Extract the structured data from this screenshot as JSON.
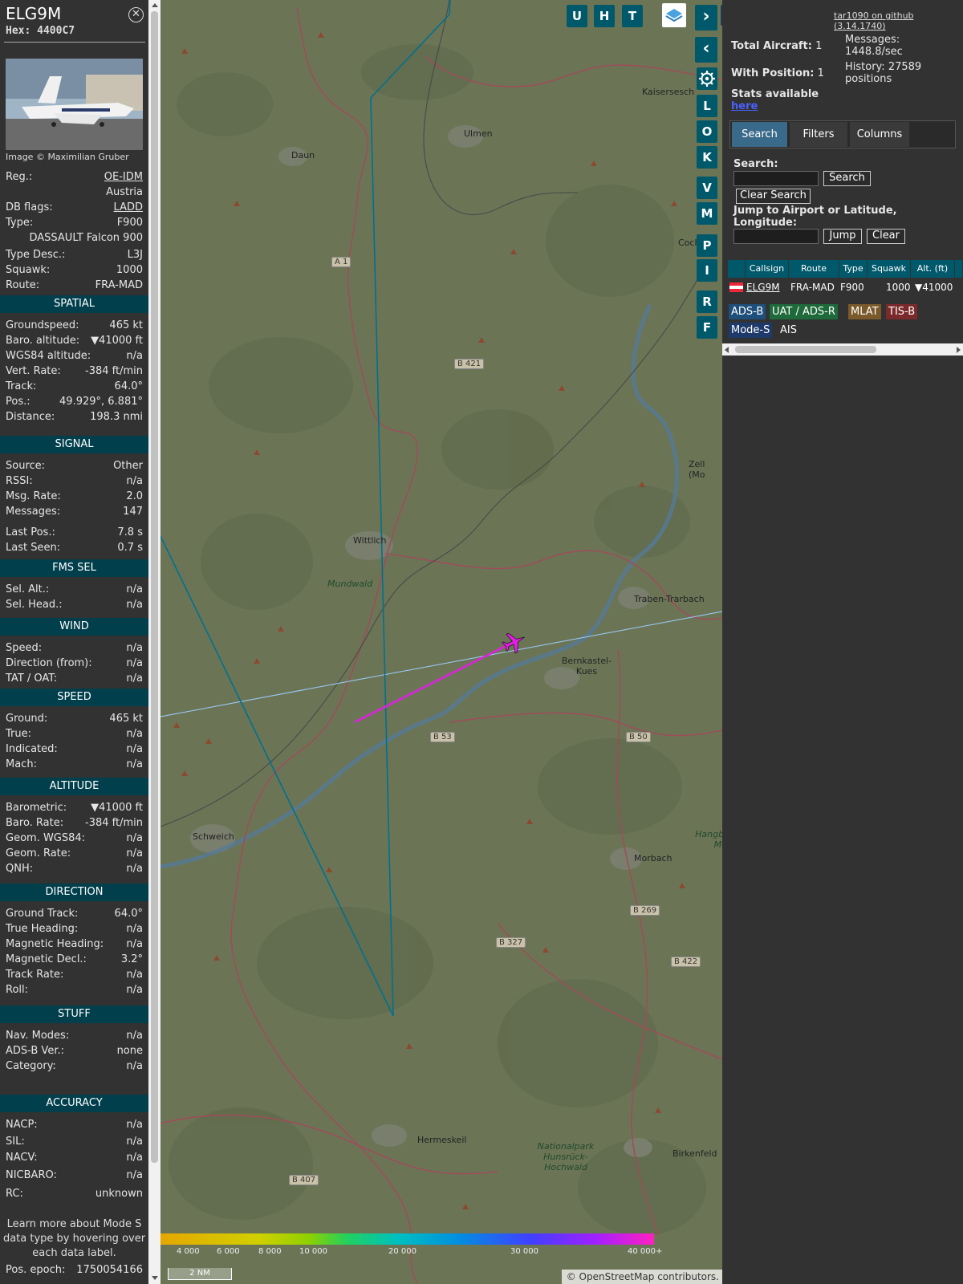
{
  "aircraft": {
    "callsign": "ELG9M",
    "hex_label": "Hex:",
    "hex": "4400C7",
    "photo_credit": "Image © Maximilian Gruber",
    "close_icon": "x"
  },
  "info": [
    {
      "k": "Reg.:",
      "v": "OE-IDM",
      "link": true
    },
    {
      "k": "",
      "v": "Austria"
    },
    {
      "k": "DB flags:",
      "v": "LADD",
      "link": true
    },
    {
      "k": "Type:",
      "v": "F900"
    },
    {
      "k": "",
      "v": "DASSAULT Falcon 900"
    },
    {
      "k": "Type Desc.:",
      "v": "L3J"
    },
    {
      "k": "Squawk:",
      "v": "1000"
    },
    {
      "k": "Route:",
      "v": "FRA-MAD"
    }
  ],
  "sections": {
    "spatial": {
      "title": "SPATIAL",
      "rows": [
        {
          "k": "Groundspeed:",
          "v": "465 kt"
        },
        {
          "k": "Baro. altitude:",
          "v": "▼41000 ft"
        },
        {
          "k": "WGS84 altitude:",
          "v": "n/a"
        },
        {
          "k": "Vert. Rate:",
          "v": "-384 ft/min"
        },
        {
          "k": "Track:",
          "v": "64.0°"
        },
        {
          "k": "Pos.:",
          "v": "49.929°, 6.881°"
        },
        {
          "k": "Distance:",
          "v": "198.3 nmi"
        }
      ]
    },
    "signal": {
      "title": "SIGNAL",
      "rows": [
        {
          "k": "Source:",
          "v": "Other"
        },
        {
          "k": "RSSI:",
          "v": "n/a"
        },
        {
          "k": "Msg. Rate:",
          "v": "2.0"
        },
        {
          "k": "Messages:",
          "v": "147"
        },
        {
          "k": "Last Pos.:",
          "v": "7.8 s"
        },
        {
          "k": "Last Seen:",
          "v": "0.7 s"
        }
      ]
    },
    "fms": {
      "title": "FMS SEL",
      "rows": [
        {
          "k": "Sel. Alt.:",
          "v": "n/a"
        },
        {
          "k": "Sel. Head.:",
          "v": "n/a"
        }
      ]
    },
    "wind": {
      "title": "WIND",
      "rows": [
        {
          "k": "Speed:",
          "v": "n/a"
        },
        {
          "k": "Direction (from):",
          "v": "n/a"
        },
        {
          "k": "TAT / OAT:",
          "v": "n/a"
        }
      ]
    },
    "speed": {
      "title": "SPEED",
      "rows": [
        {
          "k": "Ground:",
          "v": "465 kt"
        },
        {
          "k": "True:",
          "v": "n/a"
        },
        {
          "k": "Indicated:",
          "v": "n/a"
        },
        {
          "k": "Mach:",
          "v": "n/a"
        }
      ]
    },
    "altitude": {
      "title": "ALTITUDE",
      "rows": [
        {
          "k": "Barometric:",
          "v": "▼41000 ft"
        },
        {
          "k": "Baro. Rate:",
          "v": "-384 ft/min"
        },
        {
          "k": "Geom. WGS84:",
          "v": "n/a"
        },
        {
          "k": "Geom. Rate:",
          "v": "n/a"
        },
        {
          "k": "QNH:",
          "v": "n/a"
        }
      ]
    },
    "direction": {
      "title": "DIRECTION",
      "rows": [
        {
          "k": "Ground Track:",
          "v": "64.0°"
        },
        {
          "k": "True Heading:",
          "v": "n/a"
        },
        {
          "k": "Magnetic Heading:",
          "v": "n/a"
        },
        {
          "k": "Magnetic Decl.:",
          "v": "3.2°"
        },
        {
          "k": "Track Rate:",
          "v": "n/a"
        },
        {
          "k": "Roll:",
          "v": "n/a"
        }
      ]
    },
    "stuff": {
      "title": "STUFF",
      "rows": [
        {
          "k": "Nav. Modes:",
          "v": "n/a"
        },
        {
          "k": "ADS-B Ver.:",
          "v": "none"
        },
        {
          "k": "Category:",
          "v": "n/a"
        }
      ]
    },
    "accuracy": {
      "title": "ACCURACY",
      "rows": [
        {
          "k": "NACP:",
          "v": "n/a"
        },
        {
          "k": "SIL:",
          "v": "n/a"
        },
        {
          "k": "NACV:",
          "v": "n/a"
        },
        {
          "k": "NICBARO:",
          "v": "n/a"
        },
        {
          "k": "RC:",
          "v": "unknown"
        }
      ]
    }
  },
  "footer": {
    "hint": "Learn more about Mode S data type by hovering over each data label.",
    "pos_epoch_label": "Pos. epoch:",
    "pos_epoch": "1750054166"
  },
  "toolbar": {
    "top_buttons": [
      "U",
      "H",
      "T"
    ],
    "side_buttons": [
      "L",
      "O",
      "K",
      "V",
      "M",
      "P",
      "I",
      "R",
      "F"
    ],
    "layers_icon": "layers-icon",
    "settings_icon": "gear-icon"
  },
  "map": {
    "labels": [
      {
        "t": "Kaisersesch"
      },
      {
        "t": "Ulmen"
      },
      {
        "t": "Daun"
      },
      {
        "t": "Coch"
      },
      {
        "t": "Zell (Mo"
      },
      {
        "t": "Wittlich"
      },
      {
        "t": "Mundwald"
      },
      {
        "t": "Traben-Trarbach"
      },
      {
        "t": "Bernkastel-Kues"
      },
      {
        "t": "Schweich"
      },
      {
        "t": "Morbach"
      },
      {
        "t": "Hermeskeil"
      },
      {
        "t": "Birkenfeld"
      },
      {
        "t": "Nationalpark Hunsrück-Hochwald"
      },
      {
        "t": "Hangbru bei Mor"
      }
    ],
    "shields": [
      "A 1",
      "B 421",
      "B 53",
      "B 50",
      "B 269",
      "B 327",
      "B 422",
      "B 407"
    ],
    "legend_labels": [
      "4 000",
      "6 000",
      "8 000",
      "10 000",
      "20 000",
      "30 000",
      "40 000+"
    ],
    "scale": "2 NM",
    "attribution": "© OpenStreetMap contributors."
  },
  "stats": {
    "github": "tar1090 on github (3.14.1740)",
    "total_label": "Total Aircraft:",
    "total": "1",
    "withpos_label": "With Position:",
    "withpos": "1",
    "messages_label": "Messages:",
    "messages": "1448.8/sec",
    "history_label": "History:",
    "history": "27589 positions",
    "stats_label": "Stats available",
    "stats_link": "here"
  },
  "tabs": [
    "Search",
    "Filters",
    "Columns"
  ],
  "search": {
    "label": "Search:",
    "button": "Search",
    "clear_button": "Clear Search",
    "jump_label": "Jump to Airport or Latitude, Longitude:",
    "jump_button": "Jump",
    "clear": "Clear",
    "search_value": "",
    "jump_value": ""
  },
  "table": {
    "columns": [
      "",
      "Callsign",
      "Route",
      "Type",
      "Squawk",
      "Alt. (ft)"
    ],
    "rows": [
      {
        "callsign": "ELG9M",
        "route": "FRA-MAD",
        "type": "F900",
        "squawk": "1000",
        "alt": "▼41000"
      }
    ]
  },
  "badges": [
    {
      "t": "ADS-B",
      "c": "#1e4f7a"
    },
    {
      "t": "UAT / ADS-R",
      "c": "#1e6a3a"
    },
    {
      "t": "MLAT",
      "c": "#7a5a2a"
    },
    {
      "t": "TIS-B",
      "c": "#7a2a2a"
    },
    {
      "t": "Mode-S",
      "c": "#1e3a6a"
    },
    {
      "t": "AIS",
      "c": "transparent"
    }
  ],
  "colors": {
    "section_bg": "#003f4b",
    "button_bg": "#00596b",
    "track_color": "#e020e0",
    "route_line": "#005a8a"
  }
}
